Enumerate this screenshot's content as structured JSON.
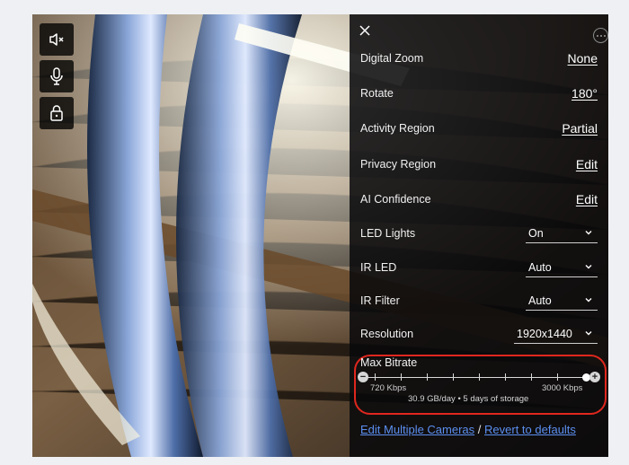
{
  "colors": {
    "highlight": "#e0271e",
    "link": "#5b8ff0",
    "panel": "#08080a"
  },
  "controls": {
    "mute_icon": "speaker-mute-icon",
    "mic_icon": "microphone-icon",
    "lock_icon": "lock-icon"
  },
  "settings": [
    {
      "label": "Digital Zoom",
      "value": "None"
    },
    {
      "label": "Rotate",
      "value": "180°"
    },
    {
      "label": "Activity Region",
      "value": "Partial"
    },
    {
      "label": "Privacy Region",
      "value": "Edit"
    },
    {
      "label": "AI Confidence",
      "value": "Edit"
    }
  ],
  "dropdowns": [
    {
      "label": "LED Lights",
      "value": "On"
    },
    {
      "label": "IR LED",
      "value": "Auto"
    },
    {
      "label": "IR Filter",
      "value": "Auto"
    },
    {
      "label": "Resolution",
      "value": "1920x1440"
    }
  ],
  "bitrate": {
    "title": "Max Bitrate",
    "min_label": "720 Kbps",
    "max_label": "3000 Kbps",
    "value_fraction": 1.0,
    "summary": "30.9 GB/day • 5 days of storage"
  },
  "footer": {
    "edit_multiple": "Edit Multiple Cameras",
    "separator": "/",
    "revert": "Revert to defaults"
  }
}
